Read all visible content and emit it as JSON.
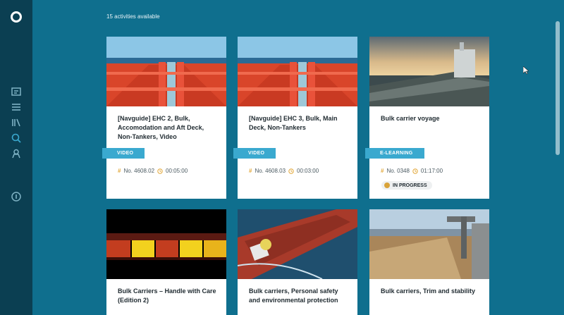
{
  "header": {
    "count_text": "15 activities available"
  },
  "sidebar": {
    "items": [
      {
        "icon": "dashboard-icon"
      },
      {
        "icon": "list-icon"
      },
      {
        "icon": "library-icon"
      },
      {
        "icon": "search-icon"
      },
      {
        "icon": "user-icon"
      },
      {
        "icon": "info-icon"
      }
    ]
  },
  "cards": [
    {
      "title": "[Navguide] EHC 2, Bulk, Accomodation and Aft Deck, Non-Tankers, Video",
      "type": "VIDEO",
      "number": "No. 4608.02",
      "duration": "00:05:00",
      "status": ""
    },
    {
      "title": "[Navguide] EHC 3, Bulk, Main Deck, Non-Tankers",
      "type": "VIDEO",
      "number": "No. 4608.03",
      "duration": "00:03:00",
      "status": ""
    },
    {
      "title": "Bulk carrier voyage",
      "type": "E-LEARNING",
      "number": "No. 0348",
      "duration": "01:17:00",
      "status": "IN PROGRESS"
    },
    {
      "title": "Bulk Carriers – Handle with Care (Edition 2)",
      "type": "",
      "number": "",
      "duration": "",
      "status": ""
    },
    {
      "title": "Bulk carriers, Personal safety and environmental protection",
      "type": "",
      "number": "",
      "duration": "",
      "status": ""
    },
    {
      "title": "Bulk carriers, Trim and stability",
      "type": "",
      "number": "",
      "duration": "",
      "status": ""
    }
  ],
  "colors": {
    "sidebar": "#0b3f52",
    "background": "#0f6f8e",
    "accent": "#3aa9cf",
    "status_dot": "#d9a33a"
  }
}
